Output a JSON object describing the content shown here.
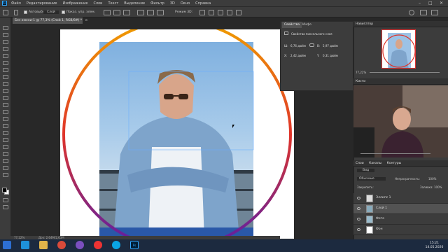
{
  "menubar": {
    "logo": "Ps",
    "items": [
      "Файл",
      "Редактирование",
      "Изображение",
      "Слои",
      "Текст",
      "Выделение",
      "Фильтр",
      "3D",
      "Окно",
      "Справка"
    ],
    "window_controls": [
      "–",
      "□",
      "✕"
    ]
  },
  "options_bar": {
    "checkbox_label": "Автовыбор:",
    "target_value": "Слой",
    "show_controls_label": "Показ. упр. элем.",
    "transform_text": "Изменить отм. элем",
    "mode_label": "Режим 3D:"
  },
  "doc_tab": {
    "title": "Без имени-1 @ 77,3% (Слой 1, RGB/8#) *",
    "close": "×"
  },
  "status": {
    "zoom": "77,22%",
    "doc_info": "Док: 2,64М/2,63М"
  },
  "properties": {
    "tabs": [
      "Свойства",
      "Инфо"
    ],
    "subtitle": "Свойства пиксельного слоя",
    "w_label": "Ш:",
    "w_value": "6,76 дюйм",
    "h_label": "В:",
    "h_value": "5,97 дюйм",
    "x_label": "X:",
    "x_value": "2,42 дюйм",
    "y_label": "Y:",
    "y_value": "0,31 дюйм"
  },
  "navigator": {
    "title": "Навигатор",
    "zoom": "77,22%"
  },
  "brushes": {
    "title": "Кисти"
  },
  "layers_panel": {
    "tabs": [
      "Слои",
      "Каналы",
      "Контуры"
    ],
    "filter_label": "Вид",
    "blend_mode": "Обычные",
    "opacity_label": "Непрозрачность:",
    "opacity_value": "100%",
    "lock_label": "Закрепить:",
    "fill_label": "Заливка:",
    "fill_value": "100%",
    "layers": [
      {
        "name": "Эллипс 1",
        "selected": false
      },
      {
        "name": "Слой 1",
        "selected": true
      },
      {
        "name": "Фото",
        "selected": false
      },
      {
        "name": "Фон",
        "selected": false
      }
    ]
  },
  "taskbar": {
    "apps": [
      "start",
      "ie",
      "explorer",
      "chrome",
      "viber",
      "yandex",
      "skype",
      "photoshop"
    ],
    "time": "15:21",
    "date": "14.05.2020"
  },
  "colors": {
    "ring_top": "#f0a000",
    "ring_mid": "#e0342a",
    "ring_bottom": "#5a1ea8",
    "accent": "#31a8ff"
  }
}
